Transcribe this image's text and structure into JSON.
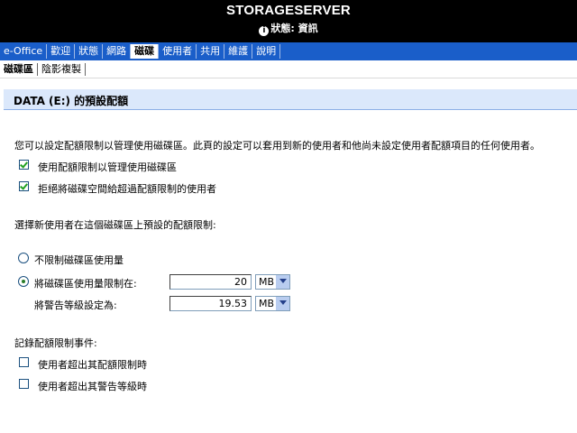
{
  "header": {
    "server_name": "STORAGESERVER",
    "status": "狀態: 資訊"
  },
  "nav": {
    "items": [
      {
        "label": "e-Office"
      },
      {
        "label": "歡迎"
      },
      {
        "label": "狀態"
      },
      {
        "label": "網路"
      },
      {
        "label": "磁碟",
        "active": true
      },
      {
        "label": "使用者"
      },
      {
        "label": "共用"
      },
      {
        "label": "維護"
      },
      {
        "label": "說明"
      }
    ]
  },
  "subnav": {
    "items": [
      {
        "label": "磁碟區",
        "active": true
      },
      {
        "label": "陰影複製"
      }
    ]
  },
  "page": {
    "title": "DATA (E:) 的預設配額",
    "intro": "您可以設定配額限制以管理使用磁碟區。此頁的設定可以套用到新的使用者和他尚未設定使用者配額項目的任何使用者。",
    "chk_enable": "使用配額限制以管理使用磁碟區",
    "chk_deny": "拒絕將磁碟空間給超過配額限制的使用者",
    "limit_heading": "選擇新使用者在這個磁碟區上預設的配額限制:",
    "radio_nolimit": "不限制磁碟區使用量",
    "radio_limit": "將磁碟區使用量限制在:",
    "limit_value": "20",
    "limit_unit": "MB",
    "warn_label": "將警告等級設定為:",
    "warn_value": "19.53",
    "warn_unit": "MB",
    "log_heading": "記錄配額限制事件:",
    "log_exceed_limit": "使用者超出其配額限制時",
    "log_exceed_warn": "使用者超出其警告等級時"
  },
  "state": {
    "chk_enable": true,
    "chk_deny": true,
    "radio_selected": "limit",
    "log_exceed_limit": false,
    "log_exceed_warn": false
  }
}
